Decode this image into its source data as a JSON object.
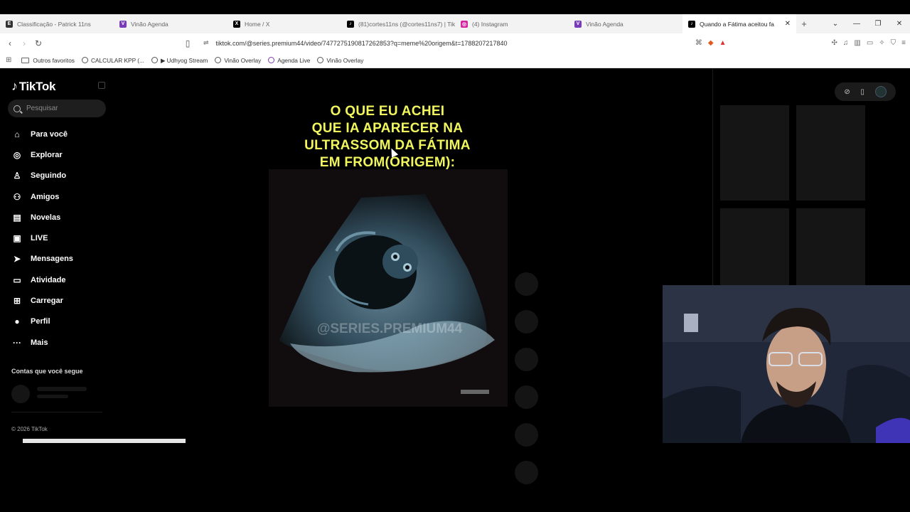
{
  "browser": {
    "tabs": [
      {
        "title": "Classificação - Patrick 11ns",
        "icon": "sheet-icon",
        "color": "#333333",
        "glyph": "E"
      },
      {
        "title": "Vinão Agenda",
        "icon": "v-logo-icon",
        "color": "#7a3bb8",
        "glyph": "V"
      },
      {
        "title": "Home / X",
        "icon": "x-logo-icon",
        "color": "#000000",
        "glyph": "X"
      },
      {
        "title": "(81)cortes11ns (@cortes11ns7) | Tik",
        "icon": "tiktok-icon",
        "color": "#000000",
        "glyph": "♪"
      },
      {
        "title": "(4) Instagram",
        "icon": "instagram-icon",
        "color": "#d6249f",
        "glyph": "◎"
      },
      {
        "title": "Vinão Agenda",
        "icon": "v-logo-icon",
        "color": "#7a3bb8",
        "glyph": "V"
      },
      {
        "title": "Quando a Fátima aceitou fa",
        "icon": "tiktok-icon",
        "color": "#000000",
        "glyph": "♪"
      }
    ],
    "new_tab": "+",
    "url": "tiktok.com/@series.premium44/video/7477275190817262853?q=meme%20origem&t=1788207217840",
    "bookmarks": [
      "Outros favoritos",
      "CALCULAR KPP (...",
      "▶ Udhyog Stream",
      "Vinão Overlay",
      "Agenda Live",
      "Vinão Overlay"
    ]
  },
  "tiktok": {
    "logo": "TikTok",
    "search_placeholder": "Pesquisar",
    "nav": [
      {
        "label": "Para você",
        "icon": "home-icon",
        "glyph": "⌂"
      },
      {
        "label": "Explorar",
        "icon": "compass-icon",
        "glyph": "◎"
      },
      {
        "label": "Seguindo",
        "icon": "following-icon",
        "glyph": "♙"
      },
      {
        "label": "Amigos",
        "icon": "friends-icon",
        "glyph": "⚇"
      },
      {
        "label": "Novelas",
        "icon": "novelas-icon",
        "glyph": "▤"
      },
      {
        "label": "LIVE",
        "icon": "live-icon",
        "glyph": "▣"
      },
      {
        "label": "Mensagens",
        "icon": "messages-icon",
        "glyph": "➤"
      },
      {
        "label": "Atividade",
        "icon": "activity-icon",
        "glyph": "▭"
      },
      {
        "label": "Carregar",
        "icon": "upload-icon",
        "glyph": "⊞"
      },
      {
        "label": "Perfil",
        "icon": "profile-avatar-icon",
        "glyph": "●"
      },
      {
        "label": "Mais",
        "icon": "more-icon",
        "glyph": "···"
      }
    ],
    "following_title": "Contas que você segue",
    "copyright": "© 2026 TikTok",
    "video": {
      "caption_lines": [
        "O QUE EU ACHEI",
        "QUE IA APARECER NA",
        "ULTRASSOM DA FÁTIMA",
        "EM FROM(ORIGEM):"
      ],
      "watermark": "@SERIES.PREMIUM44"
    }
  }
}
